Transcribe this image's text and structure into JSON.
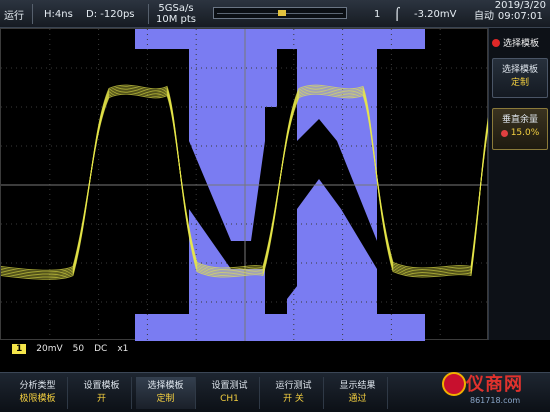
{
  "topbar": {
    "run_status": "运行",
    "horizontal": "H:4ns",
    "delay": "D: -120ps",
    "sample_rate": "5GSa/s",
    "memory_depth": "10M pts",
    "trigger_channel": "1",
    "trigger_level": "-3.20mV",
    "trigger_mode": "自动",
    "date": "2019/3/20",
    "time": "09:07:01"
  },
  "waveform": {
    "trace_color": "#e8e84a",
    "mask_color": "#7a7cf2"
  },
  "side_panel": {
    "title": "选择模板",
    "buttons": [
      {
        "label": "选择模板",
        "value": "定制"
      },
      {
        "label": "垂直余量",
        "value": "15.0%"
      }
    ]
  },
  "channel_row": {
    "channel": "1",
    "scale": "20mV",
    "impedance": "50",
    "coupling": "DC",
    "probe": "x1"
  },
  "softkeys": [
    {
      "label": "分析类型",
      "value": "极限模板"
    },
    {
      "label": "设置模板",
      "value": "开"
    },
    {
      "label": "选择模板",
      "value": "定制"
    },
    {
      "label": "设置测试",
      "value": "CH1"
    },
    {
      "label": "运行测试",
      "value": "开    关"
    },
    {
      "label": "显示结果",
      "value": "通过"
    }
  ],
  "watermark": {
    "text": "仪商网",
    "url": "861718.com"
  }
}
